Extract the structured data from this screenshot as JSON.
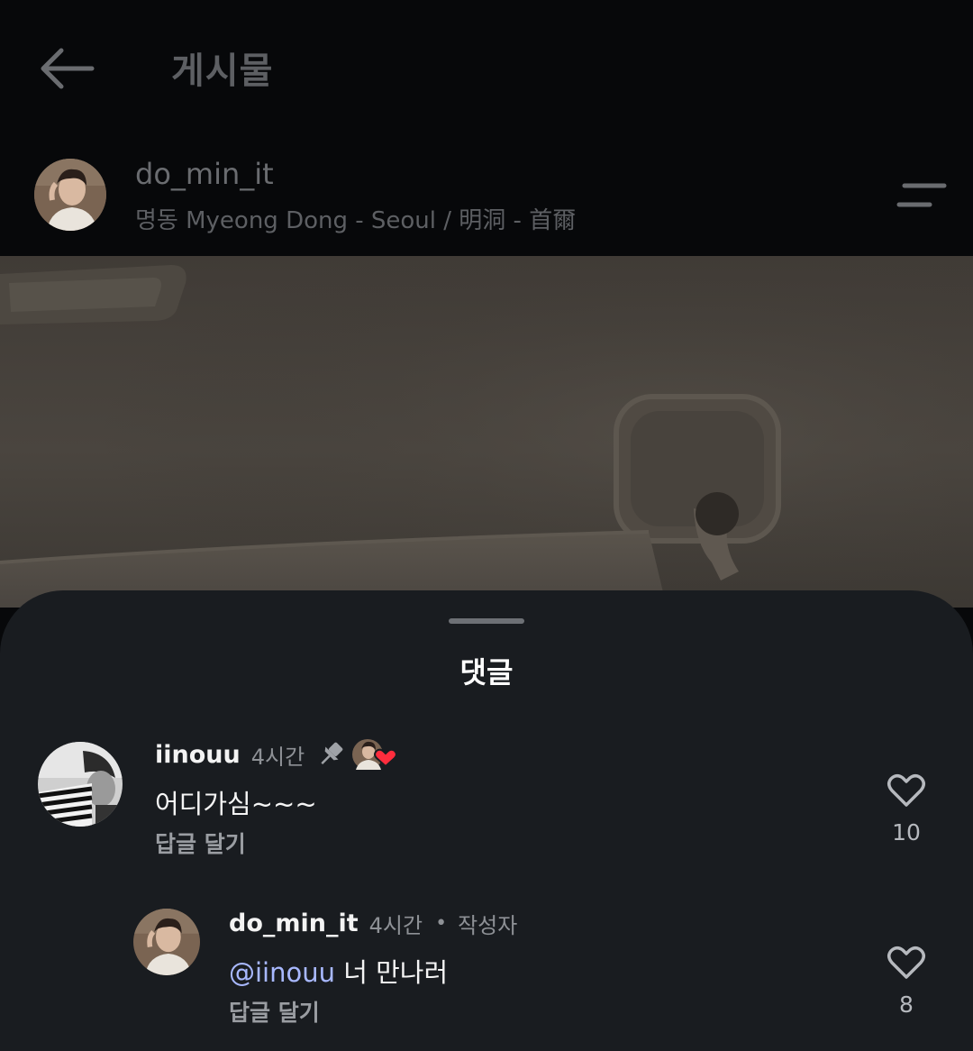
{
  "header": {
    "title": "게시물"
  },
  "post": {
    "author": "do_min_it",
    "location": "명동 Myeong Dong - Seoul / 明洞 - 首爾"
  },
  "comments_sheet": {
    "title": "댓글",
    "comments": [
      {
        "username": "iinouu",
        "time": "4시간",
        "text": "어디가심~~~",
        "reply_label": "답글 달기",
        "likes": "10",
        "pinned": true,
        "liked_by_author": true
      },
      {
        "username": "do_min_it",
        "time": "4시간",
        "badge": "작성자",
        "mention": "@iinouu",
        "text": " 너 만나러",
        "reply_label": "답글 달기",
        "likes": "8"
      }
    ]
  },
  "colors": {
    "background": "#07080a",
    "sheet": "#191c20",
    "mention": "#a8b8ff",
    "heart_badge": "#ff2d3d"
  },
  "icons": [
    "back-arrow-icon",
    "menu-icon",
    "pin-icon",
    "heart-icon"
  ]
}
